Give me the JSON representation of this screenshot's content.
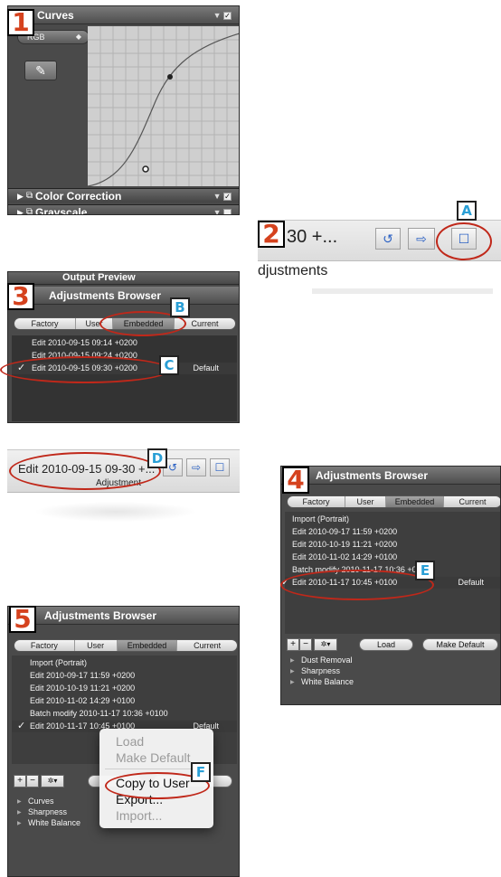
{
  "panel1": {
    "step": "1",
    "title": "Curves",
    "header_controls": "▼",
    "channel_select": "RGB",
    "eyedropper_icon": "eyedropper-icon",
    "sections": [
      {
        "label": "Color Correction"
      },
      {
        "label": "Grayscale"
      }
    ]
  },
  "panel2": {
    "step": "2",
    "letter": "A",
    "display_text": "30 +...",
    "caption": "djustments"
  },
  "panel3": {
    "step": "3",
    "header_top": "Output Preview",
    "title": "Adjustments Browser",
    "tabs": [
      "Factory",
      "User",
      "Embedded",
      "Current"
    ],
    "letter_b": "B",
    "letter_c": "C",
    "items": [
      "Edit 2010-09-15 09:14 +0200",
      "Edit 2010-09-15 09:24 +0200",
      "Edit 2010-09-15 09:30 +0200"
    ],
    "selected_check": "✓",
    "default_label": "Default"
  },
  "panel4": {
    "letter": "D",
    "display_text": "Edit 2010-09-15 09-30 +...",
    "caption": "Adjustment"
  },
  "panel5": {
    "step": "4",
    "title": "Adjustments Browser",
    "tabs": [
      "Factory",
      "User",
      "Embedded",
      "Current"
    ],
    "letter": "E",
    "items": [
      "Import (Portrait)",
      "Edit 2010-09-17 11:59 +0200",
      "Edit 2010-10-19 11:21 +0200",
      "Edit 2010-11-02 14:29 +0100",
      "Batch modify 2010-11-17 10:36 +0100",
      "Edit 2010-11-17 10:45 +0100"
    ],
    "selected_check": "✓",
    "default_label": "Default",
    "load": "Load",
    "make_default": "Make Default",
    "plus": "+",
    "minus": "−",
    "gear": "✲▾",
    "tree": [
      "Dust Removal",
      "Sharpness",
      "White Balance"
    ]
  },
  "panel6": {
    "step": "5",
    "title": "Adjustments Browser",
    "tabs": [
      "Factory",
      "User",
      "Embedded",
      "Current"
    ],
    "letter": "F",
    "items": [
      "Import (Portrait)",
      "Edit 2010-09-17 11:59 +0200",
      "Edit 2010-10-19 11:21 +0200",
      "Edit 2010-11-02 14:29 +0100",
      "Batch modify 2010-11-17 10:36 +0100",
      "Edit 2010-11-17 10:45 +0100"
    ],
    "selected_check": "✓",
    "default_label": "Default",
    "plus": "+",
    "minus": "−",
    "gear": "✲▾",
    "tree": [
      "Curves",
      "Sharpness",
      "White Balance"
    ],
    "menu": [
      "Load",
      "Make Default",
      "Copy to User",
      "Export...",
      "Import..."
    ]
  }
}
